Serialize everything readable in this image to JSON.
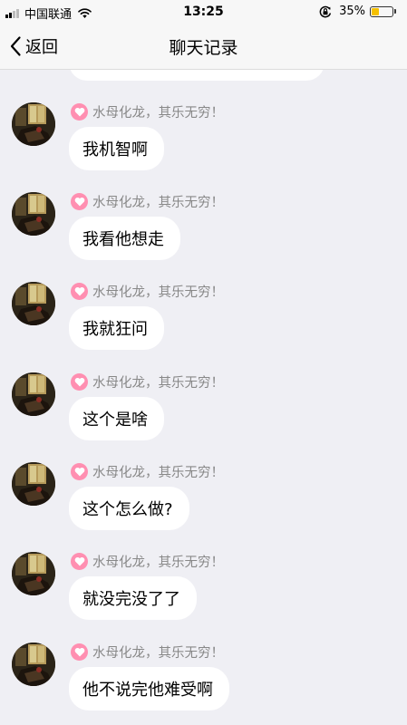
{
  "status_bar": {
    "carrier": "中国联通",
    "time": "13:25",
    "battery_percent": "35%",
    "battery_level": 0.35,
    "icons": [
      "signal-icon",
      "wifi-icon",
      "orientation-lock-icon",
      "battery-icon"
    ]
  },
  "nav": {
    "back_label": "返回",
    "back_icon": "chevron-left-icon",
    "title": "聊天记录"
  },
  "messages": [
    {
      "sender": "水母化龙，其乐无穷！",
      "text": "我机智啊"
    },
    {
      "sender": "水母化龙，其乐无穷！",
      "text": "我看他想走"
    },
    {
      "sender": "水母化龙，其乐无穷！",
      "text": "我就狂问"
    },
    {
      "sender": "水母化龙，其乐无穷！",
      "text": "这个是啥"
    },
    {
      "sender": "水母化龙，其乐无穷！",
      "text": "这个怎么做?"
    },
    {
      "sender": "水母化龙，其乐无穷！",
      "text": "就没完没了了"
    },
    {
      "sender": "水母化龙，其乐无穷！",
      "text": "他不说完他难受啊"
    }
  ],
  "colors": {
    "background": "#efeff4",
    "bubble": "#ffffff",
    "heart_badge": "#ff8fb1",
    "sender_name": "#888888",
    "battery_fill": "#f5c000"
  }
}
